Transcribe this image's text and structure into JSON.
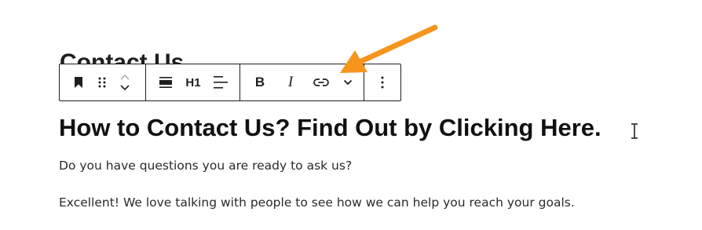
{
  "page_title": "Contact Us",
  "toolbar": {
    "block_icon": "bookmark-icon",
    "drag_icon": "drag-handle-icon",
    "move_icon": "chevron-up-down-icon",
    "align_icon": "align-wide-icon",
    "heading_level": "H1",
    "text_align_icon": "align-left-icon",
    "bold_label": "B",
    "italic_label": "I",
    "link_icon": "link-icon",
    "more_formatting_icon": "chevron-down-icon",
    "options_icon": "kebab-menu-icon"
  },
  "content": {
    "heading": "How to Contact Us? Find Out by Clicking Here.",
    "paragraphs": [
      "Do you have questions you are ready to ask us?",
      "Excellent! We love talking with people to see how we can help you reach your goals."
    ]
  },
  "annotation": {
    "arrow_color": "#f7941d"
  },
  "cursor": "text-cursor-icon"
}
